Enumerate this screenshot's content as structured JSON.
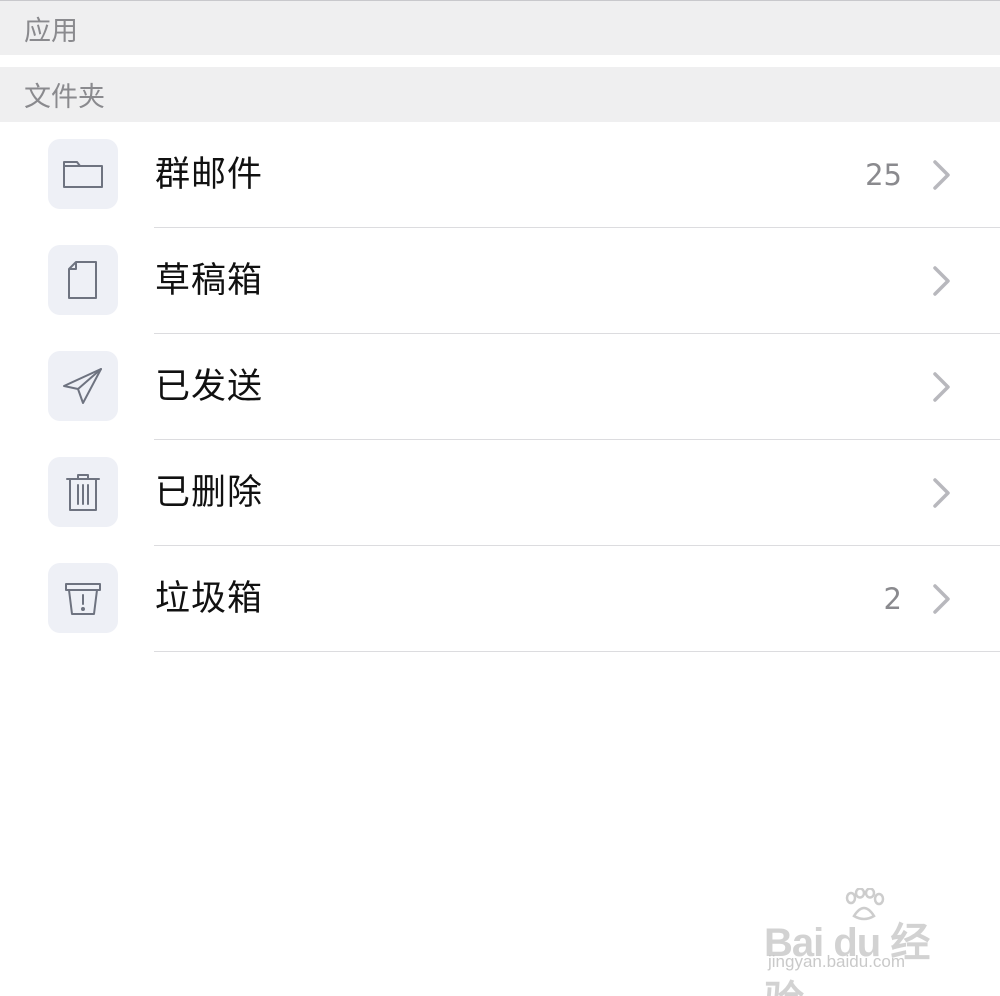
{
  "sections": {
    "apps_title": "应用",
    "folders_title": "文件夹"
  },
  "folders": [
    {
      "label": "群邮件",
      "count": "25",
      "icon": "folder-icon"
    },
    {
      "label": "草稿箱",
      "count": "",
      "icon": "draft-document-icon"
    },
    {
      "label": "已发送",
      "count": "",
      "icon": "paper-plane-icon"
    },
    {
      "label": "已删除",
      "count": "",
      "icon": "trash-icon"
    },
    {
      "label": "垃圾箱",
      "count": "2",
      "icon": "spam-bin-icon"
    }
  ],
  "watermark": {
    "brand": "Bai du 经验",
    "url": "jingyan.baidu.com"
  },
  "colors": {
    "section_bg": "#efeff0",
    "section_text": "#8a8a8e",
    "icon_bg": "#eef0f6",
    "icon_stroke": "#6e7380",
    "chevron": "#b8b8bd"
  }
}
